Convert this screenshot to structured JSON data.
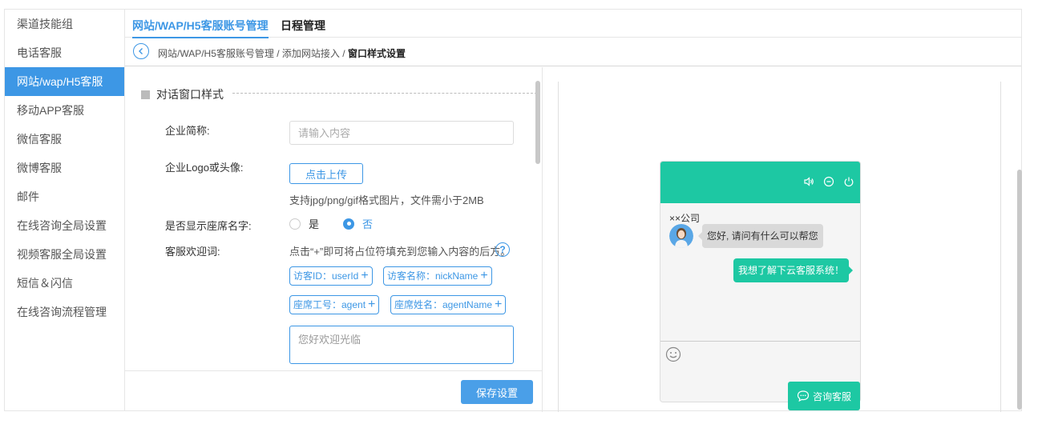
{
  "sidebar": {
    "items": [
      {
        "label": "渠道技能组"
      },
      {
        "label": "电话客服"
      },
      {
        "label": "网站/wap/H5客服"
      },
      {
        "label": "移动APP客服"
      },
      {
        "label": "微信客服"
      },
      {
        "label": "微博客服"
      },
      {
        "label": "邮件"
      },
      {
        "label": "在线咨询全局设置"
      },
      {
        "label": "视频客服全局设置"
      },
      {
        "label": "短信＆闪信"
      },
      {
        "label": "在线咨询流程管理"
      }
    ],
    "active_index": 2
  },
  "tabs": [
    {
      "label": "网站/WAP/H5客服账号管理",
      "active": true
    },
    {
      "label": "日程管理",
      "active": false
    }
  ],
  "breadcrumb": {
    "item1": "网站/WAP/H5客服账号管理",
    "sep": " / ",
    "item2": "添加网站接入",
    "current": "窗口样式设置"
  },
  "form": {
    "section_title": "对话窗口样式",
    "company_label": "企业简称:",
    "company_placeholder": "请输入内容",
    "logo_label": "企业Logo或头像:",
    "upload_label": "点击上传",
    "upload_hint": "支持jpg/png/gif格式图片，文件需小于2MB",
    "show_name_label": "是否显示座席名字:",
    "radio_yes": "是",
    "radio_no": "否",
    "selected": "否",
    "welcome_label": "客服欢迎词:",
    "welcome_hint": "点击“+”即可将占位符填充到您输入内容的后方。",
    "help_icon": "?",
    "tags": [
      {
        "label": "访客ID：userId"
      },
      {
        "label": "访客名称：nickName"
      },
      {
        "label": "座席工号：agent"
      },
      {
        "label": "座席姓名：agentName"
      }
    ],
    "tag_plus": "+",
    "welcome_placeholder": "您好欢迎光临",
    "save_label": "保存设置"
  },
  "preview": {
    "company": "××公司",
    "greeting": "您好, 请问有什么可以帮您",
    "user_message": "我想了解下云客服系统！",
    "consult_label": "咨询客服"
  },
  "colors": {
    "accent": "#3d97e5",
    "widget_brand": "#1dc8a3"
  }
}
